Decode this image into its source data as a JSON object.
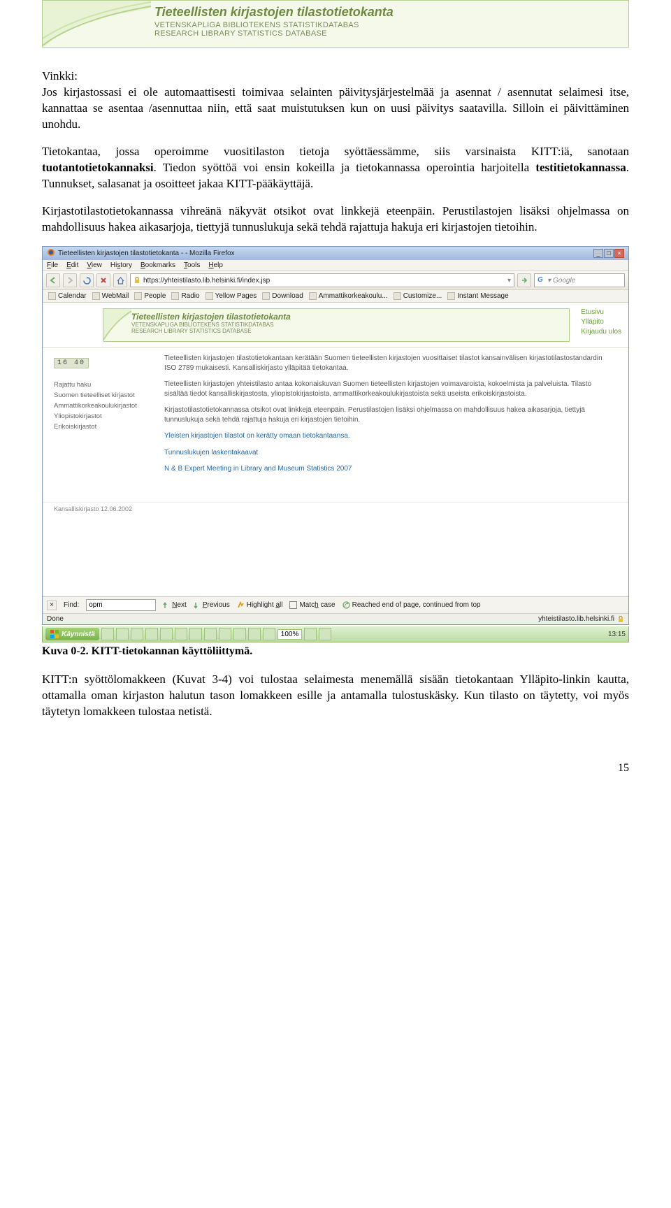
{
  "page_banner": {
    "title": "Tieteellisten kirjastojen tilastotietokanta",
    "sub1": "VETENSKAPLIGA BIBLIOTEKENS STATISTIKDATABAS",
    "sub2": "RESEARCH LIBRARY STATISTICS DATABASE"
  },
  "prose": {
    "vinkki_label": "Vinkki:",
    "p1": "Jos kirjastossasi ei ole automaattisesti toimivaa selainten päivitysjärjestelmää ja asennat / asennutat selaimesi itse, kannattaa se asentaa /asennuttaa niin, että saat muistutuksen kun on uusi päivitys saatavilla. Silloin ei päivittäminen unohdu.",
    "p2a": "Tietokantaa, jossa operoimme vuositilaston tietoja syöttäessämme, siis varsinaista KITT:iä, sanotaan ",
    "p2b": "tuotantotietokannaksi",
    "p2c": ". Tiedon syöttöä voi ensin kokeilla ja tietokannassa operointia harjoitella ",
    "p2d": "testitietokannassa",
    "p2e": ". Tunnukset, salasanat ja osoitteet jakaa KITT-pääkäyttäjä.",
    "p3": "Kirjastotilastotietokannassa vihreänä näkyvät otsikot ovat linkkejä eteenpäin. Perustilastojen lisäksi ohjelmassa on mahdollisuus hakea aikasarjoja, tiettyjä tunnuslukuja sekä tehdä rajattuja hakuja eri kirjastojen tietoihin.",
    "caption": "Kuva 0-2. KITT-tietokannan käyttöliittymä.",
    "p4": "KITT:n syöttölomakkeen (Kuvat 3-4) voi tulostaa selaimesta menemällä sisään tietokantaan Ylläpito-linkin kautta, ottamalla oman kirjaston halutun tason lomakkeen esille ja antamalla tulostuskäsky. Kun tilasto on täytetty, voi myös täytetyn lomakkeen tulostaa netistä.",
    "pagenum": "15"
  },
  "ff": {
    "window_title": "Tieteellisten kirjastojen tilastotietokanta - - Mozilla Firefox",
    "menu": {
      "file": "File",
      "edit": "Edit",
      "view": "View",
      "history": "History",
      "bookmarks": "Bookmarks",
      "tools": "Tools",
      "help": "Help"
    },
    "url": "https://yhteistilasto.lib.helsinki.fi/index.jsp",
    "search_placeholder": "Google",
    "bookmarks": [
      "Calendar",
      "WebMail",
      "People",
      "Radio",
      "Yellow Pages",
      "Download",
      "Ammattikorkeakoulu...",
      "Customize...",
      "Instant Message"
    ],
    "find": {
      "label": "Find:",
      "value": "opm",
      "next": "Next",
      "prev": "Previous",
      "hl": "Highlight all",
      "match": "Match case",
      "msg": "Reached end of page, continued from top"
    },
    "status_left": "Done",
    "status_right": "yhteistilasto.lib.helsinki.fi"
  },
  "site": {
    "counter": "16 40",
    "banner": {
      "t1": "Tieteellisten kirjastojen tilastotietokanta",
      "t2a": "VETENSKAPLIGA BIBLIOTEKENS STATISTIKDATABAS",
      "t2b": "RESEARCH LIBRARY STATISTICS DATABASE"
    },
    "topnav": {
      "a": "Etusivu",
      "b": "Ylläpito",
      "c": "Kirjaudu ulos"
    },
    "leftnav": {
      "a": "Rajattu haku",
      "b": "Suomen tieteelliset kirjastot",
      "c": "Ammattikorkeakoulukirjastot",
      "d": "Yliopistokirjastot",
      "e": "Erikoiskirjastot"
    },
    "main": {
      "p1": "Tieteellisten kirjastojen tilastotietokantaan kerätään Suomen tieteellisten kirjastojen vuosittaiset tilastot kansainvälisen kirjastotilastostandardin ISO 2789 mukaisesti. Kansalliskirjasto ylläpitää tietokantaa.",
      "p2": "Tieteellisten kirjastojen yhteistilasto antaa kokonaiskuvan Suomen tieteellisten kirjastojen voimavaroista, kokoelmista ja palveluista. Tilasto sisältää tiedot kansalliskirjastosta, yliopistokirjastoista, ammattikorkeakoulukirjastoista sekä useista erikoiskirjastoista.",
      "p3": "Kirjastotilastotietokannassa otsikot ovat linkkejä eteenpäin. Perustilastojen lisäksi ohjelmassa on mahdollisuus hakea aikasarjoja, tiettyjä tunnuslukuja sekä tehdä rajattuja hakuja eri kirjastojen tietoihin.",
      "p4": "Yleisten kirjastojen tilastot on kerätty omaan tietokantaansa.",
      "p5": "Tunnuslukujen laskentakaavat",
      "p6": "N & B Expert Meeting in Library and Museum Statistics 2007"
    },
    "footer": "Kansalliskirjasto 12.06.2002"
  },
  "taskbar": {
    "start": "Käynnistä",
    "zoom": "100%",
    "clock": "13:15"
  }
}
